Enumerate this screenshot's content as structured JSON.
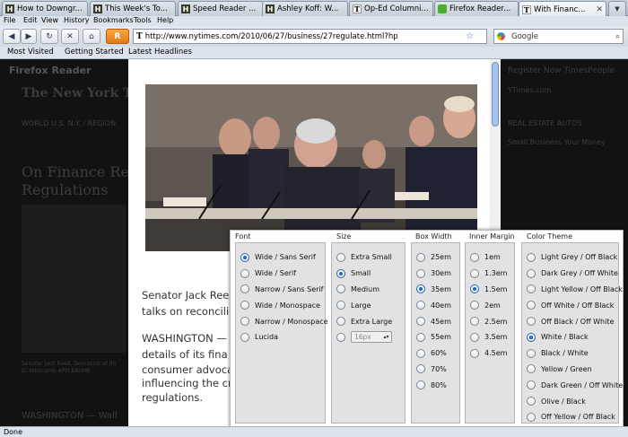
{
  "tabs": [
    {
      "title": "How to Downgr...",
      "favicon": "H",
      "active": false
    },
    {
      "title": "This Week's To...",
      "favicon": "H",
      "active": false
    },
    {
      "title": "Speed Reader ...",
      "favicon": "H",
      "active": false
    },
    {
      "title": "Ashley Koff: W...",
      "favicon": "H",
      "active": false
    },
    {
      "title": "Op-Ed Columni...",
      "favicon": "T",
      "active": false
    },
    {
      "title": "Firefox Reader...",
      "favicon": "puzzle",
      "active": false
    },
    {
      "title": "With Financ...",
      "favicon": "T",
      "active": true
    }
  ],
  "menu": [
    "File",
    "Edit",
    "View",
    "History",
    "Bookmarks",
    "Tools",
    "Help"
  ],
  "url": "http://www.nytimes.com/2010/06/27/business/27regulate.html?hp",
  "search_placeholder": "Google",
  "bookmarks": [
    "Most Visited",
    "Getting Started",
    "Latest Headlines"
  ],
  "background_page": {
    "reader_label": "Firefox Reader",
    "masthead": "The New York Times",
    "nav": "WORLD   U.S.   N.Y. / REGION",
    "nav_right": "REAL ESTATE   AUTOS",
    "headline_1": "On Finance Refo",
    "headline_2": "Regulations",
    "right_links": "Register Now   TimesPeople",
    "right_sub": "YTimes.com",
    "right_tabs": "Small Business   Your Money",
    "caption": "WASHINGTON — Wall",
    "photo_caption_1": "Senator Jack Reed, Democrat of Rh",
    "photo_caption_2": "D. Whitcomb APPLEBOME"
  },
  "article": {
    "line1": "Senator Jack Ree",
    "line2": "talks on reconcilin",
    "line3": "WASHINGTON —",
    "line4": "details of its fina",
    "line5": "consumer advoca",
    "line6": "influencing the cr",
    "line7": "regulations."
  },
  "settings": {
    "font": {
      "heading": "Font",
      "options": [
        "Wide / Sans Serif",
        "Wide / Serif",
        "Narrow / Sans Serif",
        "Wide / Monospace",
        "Narrow / Monospace",
        "Lucida"
      ],
      "selected": 0
    },
    "size": {
      "heading": "Size",
      "options": [
        "Extra Small",
        "Small",
        "Medium",
        "Large",
        "Extra Large"
      ],
      "selected": 1,
      "custom_value": "16px"
    },
    "box_width": {
      "heading": "Box Width",
      "options": [
        "25em",
        "30em",
        "35em",
        "40em",
        "45em",
        "55em",
        "60%",
        "70%",
        "80%"
      ],
      "selected": 2
    },
    "inner_margin": {
      "heading": "Inner Margin",
      "options": [
        "1em",
        "1.3em",
        "1.5em",
        "2em",
        "2.5em",
        "3.5em",
        "4.5em"
      ],
      "selected": 2
    },
    "color_theme": {
      "heading": "Color Theme",
      "options": [
        "Light Grey / Off Black",
        "Dark Grey / Off White",
        "Light Yellow / Off Black",
        "Off White / Off Black",
        "Off Black / Off White",
        "White / Black",
        "Black / White",
        "Yellow / Green",
        "Dark Green / Off White",
        "Olive / Black",
        "Off Yellow / Off Black"
      ],
      "selected": 5
    }
  },
  "status": "Done"
}
